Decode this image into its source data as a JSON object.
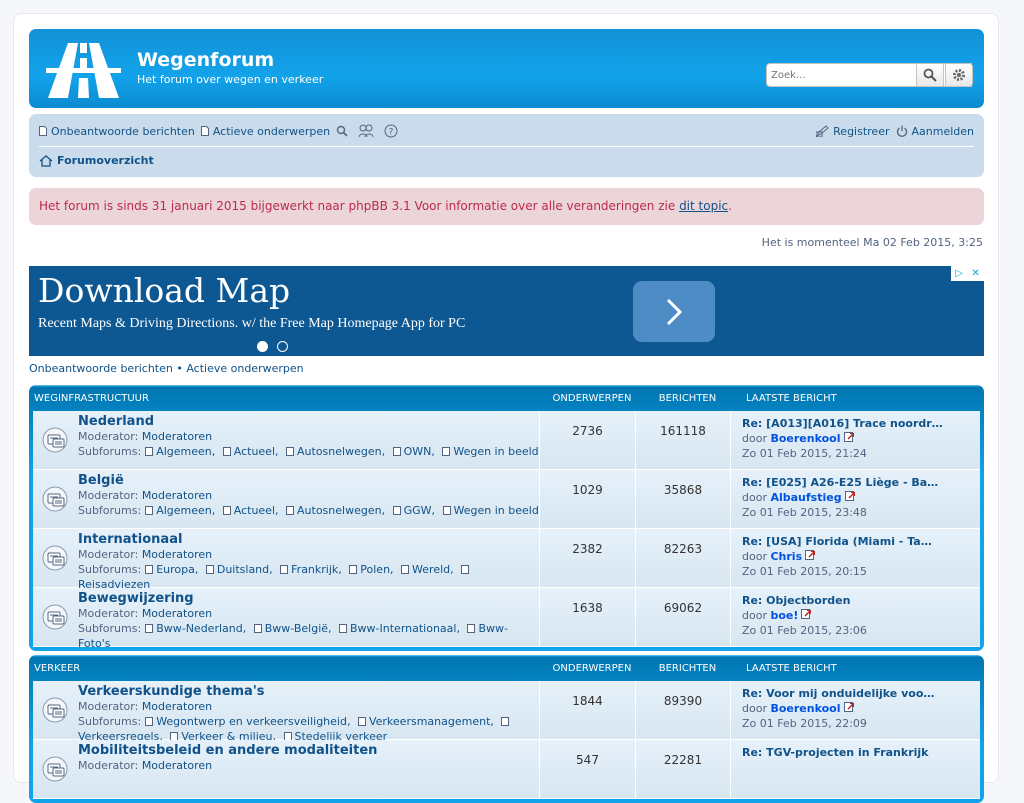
{
  "site": {
    "title": "Wegenforum",
    "description": "Het forum over wegen en verkeer"
  },
  "search": {
    "placeholder": "Zoek…"
  },
  "nav": {
    "unanswered": "Onbeantwoorde berichten",
    "active": "Actieve onderwerpen",
    "register": "Registreer",
    "login": "Aanmelden",
    "index": "Forumoverzicht"
  },
  "notice": {
    "text": "Het forum is sinds 31 januari 2015 bijgewerkt naar phpBB 3.1 Voor informatie over alle veranderingen zie ",
    "link": "dit topic",
    "end": "."
  },
  "time": "Het is momenteel Ma 02 Feb 2015, 3:25",
  "ad": {
    "title": "Download Map",
    "subtitle": "Recent Maps & Driving Directions. w/ the Free Map Homepage App for PC"
  },
  "quicklinks": {
    "unanswered": "Onbeantwoorde berichten",
    "sep": " • ",
    "active": "Actieve onderwerpen"
  },
  "columns": {
    "topics": "ONDERWERPEN",
    "posts": "BERICHTEN",
    "last": "LAATSTE BERICHT"
  },
  "labels": {
    "moderator": "Moderator:",
    "moderators": "Moderatoren",
    "subforums": "Subforums:",
    "by": "door"
  },
  "categories": [
    {
      "name": "WEGINFRASTRUCTUUR",
      "forums": [
        {
          "name": "Nederland",
          "subforums": [
            "Algemeen,",
            "Actueel,",
            "Autosnelwegen,",
            "OWN,",
            "Wegen in beeld"
          ],
          "topics": "2736",
          "posts": "161118",
          "last_title": "Re: [A013][A016] Trace noordr…",
          "last_user": "Boerenkool",
          "last_date": "Zo 01 Feb 2015, 21:24"
        },
        {
          "name": "België",
          "subforums": [
            "Algemeen,",
            "Actueel,",
            "Autosnelwegen,",
            "GGW,",
            "Wegen in beeld"
          ],
          "topics": "1029",
          "posts": "35868",
          "last_title": "Re: [E025] A26-E25 Liège - Ba…",
          "last_user": "Albaufstieg",
          "last_date": "Zo 01 Feb 2015, 23:48"
        },
        {
          "name": "Internationaal",
          "subforums": [
            "Europa,",
            "Duitsland,",
            "Frankrijk,",
            "Polen,",
            "Wereld,",
            "Reisadviezen"
          ],
          "topics": "2382",
          "posts": "82263",
          "last_title": "Re: [USA] Florida (Miami - Ta…",
          "last_user": "Chris",
          "last_date": "Zo 01 Feb 2015, 20:15"
        },
        {
          "name": "Bewegwijzering",
          "subforums": [
            "Bww-Nederland,",
            "Bww-België,",
            "Bww-Internationaal,",
            "Bww-Foto's"
          ],
          "topics": "1638",
          "posts": "69062",
          "last_title": "Re: Objectborden",
          "last_user": "boe!",
          "last_date": "Zo 01 Feb 2015, 23:06"
        }
      ]
    },
    {
      "name": "VERKEER",
      "forums": [
        {
          "name": "Verkeerskundige thema's",
          "subforums": [
            "Wegontwerp en verkeersveiligheid,",
            "Verkeersmanagement,",
            "Verkeersregels,",
            "Verkeer & milieu,",
            "Stedelijk verkeer"
          ],
          "topics": "1844",
          "posts": "89390",
          "last_title": "Re: Voor mij onduidelijke voo…",
          "last_user": "Boerenkool",
          "last_date": "Zo 01 Feb 2015, 22:09"
        },
        {
          "name": "Mobiliteitsbeleid en andere modaliteiten",
          "subforums": [],
          "topics": "547",
          "posts": "22281",
          "last_title": "Re: TGV-projecten in Frankrijk",
          "last_user": "",
          "last_date": ""
        }
      ]
    }
  ]
}
